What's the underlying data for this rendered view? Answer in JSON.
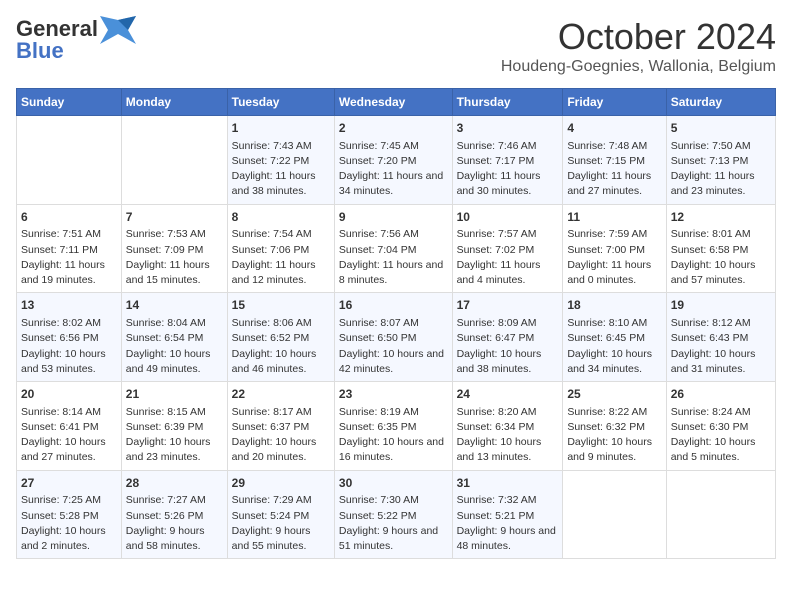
{
  "header": {
    "logo_general": "General",
    "logo_blue": "Blue",
    "title": "October 2024",
    "subtitle": "Houdeng-Goegnies, Wallonia, Belgium"
  },
  "weekdays": [
    "Sunday",
    "Monday",
    "Tuesday",
    "Wednesday",
    "Thursday",
    "Friday",
    "Saturday"
  ],
  "rows": [
    [
      {
        "day": "",
        "sunrise": "",
        "sunset": "",
        "daylight": ""
      },
      {
        "day": "",
        "sunrise": "",
        "sunset": "",
        "daylight": ""
      },
      {
        "day": "1",
        "sunrise": "Sunrise: 7:43 AM",
        "sunset": "Sunset: 7:22 PM",
        "daylight": "Daylight: 11 hours and 38 minutes."
      },
      {
        "day": "2",
        "sunrise": "Sunrise: 7:45 AM",
        "sunset": "Sunset: 7:20 PM",
        "daylight": "Daylight: 11 hours and 34 minutes."
      },
      {
        "day": "3",
        "sunrise": "Sunrise: 7:46 AM",
        "sunset": "Sunset: 7:17 PM",
        "daylight": "Daylight: 11 hours and 30 minutes."
      },
      {
        "day": "4",
        "sunrise": "Sunrise: 7:48 AM",
        "sunset": "Sunset: 7:15 PM",
        "daylight": "Daylight: 11 hours and 27 minutes."
      },
      {
        "day": "5",
        "sunrise": "Sunrise: 7:50 AM",
        "sunset": "Sunset: 7:13 PM",
        "daylight": "Daylight: 11 hours and 23 minutes."
      }
    ],
    [
      {
        "day": "6",
        "sunrise": "Sunrise: 7:51 AM",
        "sunset": "Sunset: 7:11 PM",
        "daylight": "Daylight: 11 hours and 19 minutes."
      },
      {
        "day": "7",
        "sunrise": "Sunrise: 7:53 AM",
        "sunset": "Sunset: 7:09 PM",
        "daylight": "Daylight: 11 hours and 15 minutes."
      },
      {
        "day": "8",
        "sunrise": "Sunrise: 7:54 AM",
        "sunset": "Sunset: 7:06 PM",
        "daylight": "Daylight: 11 hours and 12 minutes."
      },
      {
        "day": "9",
        "sunrise": "Sunrise: 7:56 AM",
        "sunset": "Sunset: 7:04 PM",
        "daylight": "Daylight: 11 hours and 8 minutes."
      },
      {
        "day": "10",
        "sunrise": "Sunrise: 7:57 AM",
        "sunset": "Sunset: 7:02 PM",
        "daylight": "Daylight: 11 hours and 4 minutes."
      },
      {
        "day": "11",
        "sunrise": "Sunrise: 7:59 AM",
        "sunset": "Sunset: 7:00 PM",
        "daylight": "Daylight: 11 hours and 0 minutes."
      },
      {
        "day": "12",
        "sunrise": "Sunrise: 8:01 AM",
        "sunset": "Sunset: 6:58 PM",
        "daylight": "Daylight: 10 hours and 57 minutes."
      }
    ],
    [
      {
        "day": "13",
        "sunrise": "Sunrise: 8:02 AM",
        "sunset": "Sunset: 6:56 PM",
        "daylight": "Daylight: 10 hours and 53 minutes."
      },
      {
        "day": "14",
        "sunrise": "Sunrise: 8:04 AM",
        "sunset": "Sunset: 6:54 PM",
        "daylight": "Daylight: 10 hours and 49 minutes."
      },
      {
        "day": "15",
        "sunrise": "Sunrise: 8:06 AM",
        "sunset": "Sunset: 6:52 PM",
        "daylight": "Daylight: 10 hours and 46 minutes."
      },
      {
        "day": "16",
        "sunrise": "Sunrise: 8:07 AM",
        "sunset": "Sunset: 6:50 PM",
        "daylight": "Daylight: 10 hours and 42 minutes."
      },
      {
        "day": "17",
        "sunrise": "Sunrise: 8:09 AM",
        "sunset": "Sunset: 6:47 PM",
        "daylight": "Daylight: 10 hours and 38 minutes."
      },
      {
        "day": "18",
        "sunrise": "Sunrise: 8:10 AM",
        "sunset": "Sunset: 6:45 PM",
        "daylight": "Daylight: 10 hours and 34 minutes."
      },
      {
        "day": "19",
        "sunrise": "Sunrise: 8:12 AM",
        "sunset": "Sunset: 6:43 PM",
        "daylight": "Daylight: 10 hours and 31 minutes."
      }
    ],
    [
      {
        "day": "20",
        "sunrise": "Sunrise: 8:14 AM",
        "sunset": "Sunset: 6:41 PM",
        "daylight": "Daylight: 10 hours and 27 minutes."
      },
      {
        "day": "21",
        "sunrise": "Sunrise: 8:15 AM",
        "sunset": "Sunset: 6:39 PM",
        "daylight": "Daylight: 10 hours and 23 minutes."
      },
      {
        "day": "22",
        "sunrise": "Sunrise: 8:17 AM",
        "sunset": "Sunset: 6:37 PM",
        "daylight": "Daylight: 10 hours and 20 minutes."
      },
      {
        "day": "23",
        "sunrise": "Sunrise: 8:19 AM",
        "sunset": "Sunset: 6:35 PM",
        "daylight": "Daylight: 10 hours and 16 minutes."
      },
      {
        "day": "24",
        "sunrise": "Sunrise: 8:20 AM",
        "sunset": "Sunset: 6:34 PM",
        "daylight": "Daylight: 10 hours and 13 minutes."
      },
      {
        "day": "25",
        "sunrise": "Sunrise: 8:22 AM",
        "sunset": "Sunset: 6:32 PM",
        "daylight": "Daylight: 10 hours and 9 minutes."
      },
      {
        "day": "26",
        "sunrise": "Sunrise: 8:24 AM",
        "sunset": "Sunset: 6:30 PM",
        "daylight": "Daylight: 10 hours and 5 minutes."
      }
    ],
    [
      {
        "day": "27",
        "sunrise": "Sunrise: 7:25 AM",
        "sunset": "Sunset: 5:28 PM",
        "daylight": "Daylight: 10 hours and 2 minutes."
      },
      {
        "day": "28",
        "sunrise": "Sunrise: 7:27 AM",
        "sunset": "Sunset: 5:26 PM",
        "daylight": "Daylight: 9 hours and 58 minutes."
      },
      {
        "day": "29",
        "sunrise": "Sunrise: 7:29 AM",
        "sunset": "Sunset: 5:24 PM",
        "daylight": "Daylight: 9 hours and 55 minutes."
      },
      {
        "day": "30",
        "sunrise": "Sunrise: 7:30 AM",
        "sunset": "Sunset: 5:22 PM",
        "daylight": "Daylight: 9 hours and 51 minutes."
      },
      {
        "day": "31",
        "sunrise": "Sunrise: 7:32 AM",
        "sunset": "Sunset: 5:21 PM",
        "daylight": "Daylight: 9 hours and 48 minutes."
      },
      {
        "day": "",
        "sunrise": "",
        "sunset": "",
        "daylight": ""
      },
      {
        "day": "",
        "sunrise": "",
        "sunset": "",
        "daylight": ""
      }
    ]
  ]
}
